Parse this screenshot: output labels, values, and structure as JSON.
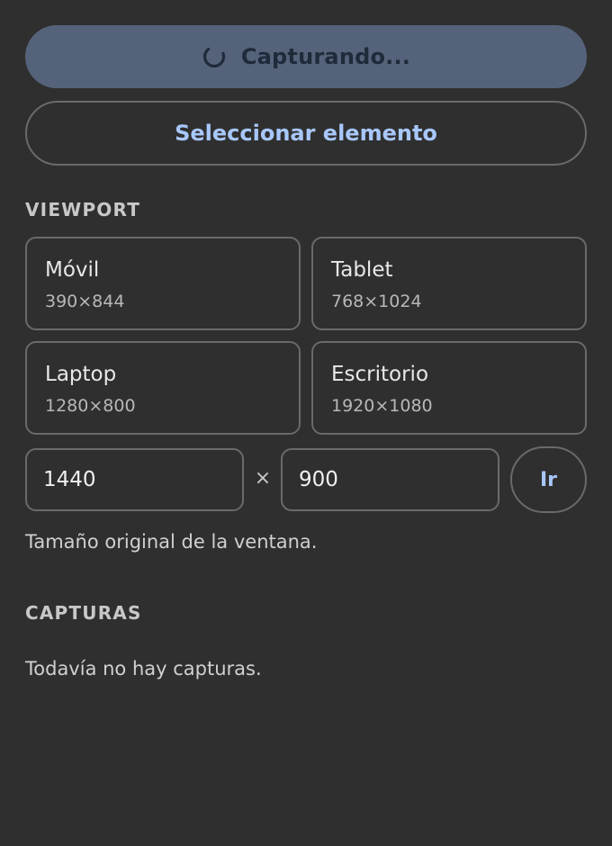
{
  "capture_button": {
    "label": "Capturando...",
    "state": "loading",
    "icon": "spinner-icon"
  },
  "select_button": {
    "label": "Seleccionar elemento"
  },
  "viewport": {
    "heading": "VIEWPORT",
    "presets": [
      {
        "name": "Móvil",
        "dims": "390×844"
      },
      {
        "name": "Tablet",
        "dims": "768×1024"
      },
      {
        "name": "Laptop",
        "dims": "1280×800"
      },
      {
        "name": "Escritorio",
        "dims": "1920×1080"
      }
    ],
    "width_value": "1440",
    "separator": "×",
    "height_value": "900",
    "go_label": "Ir",
    "status": "Tamaño original de la ventana."
  },
  "captures": {
    "heading": "CAPTURAS",
    "empty_text": "Todavía no hay capturas."
  },
  "colors": {
    "background": "#2f2f2f",
    "primary_button_bg": "#55637a",
    "accent_text": "#a8c7fa",
    "border": "#6a6a6a"
  }
}
